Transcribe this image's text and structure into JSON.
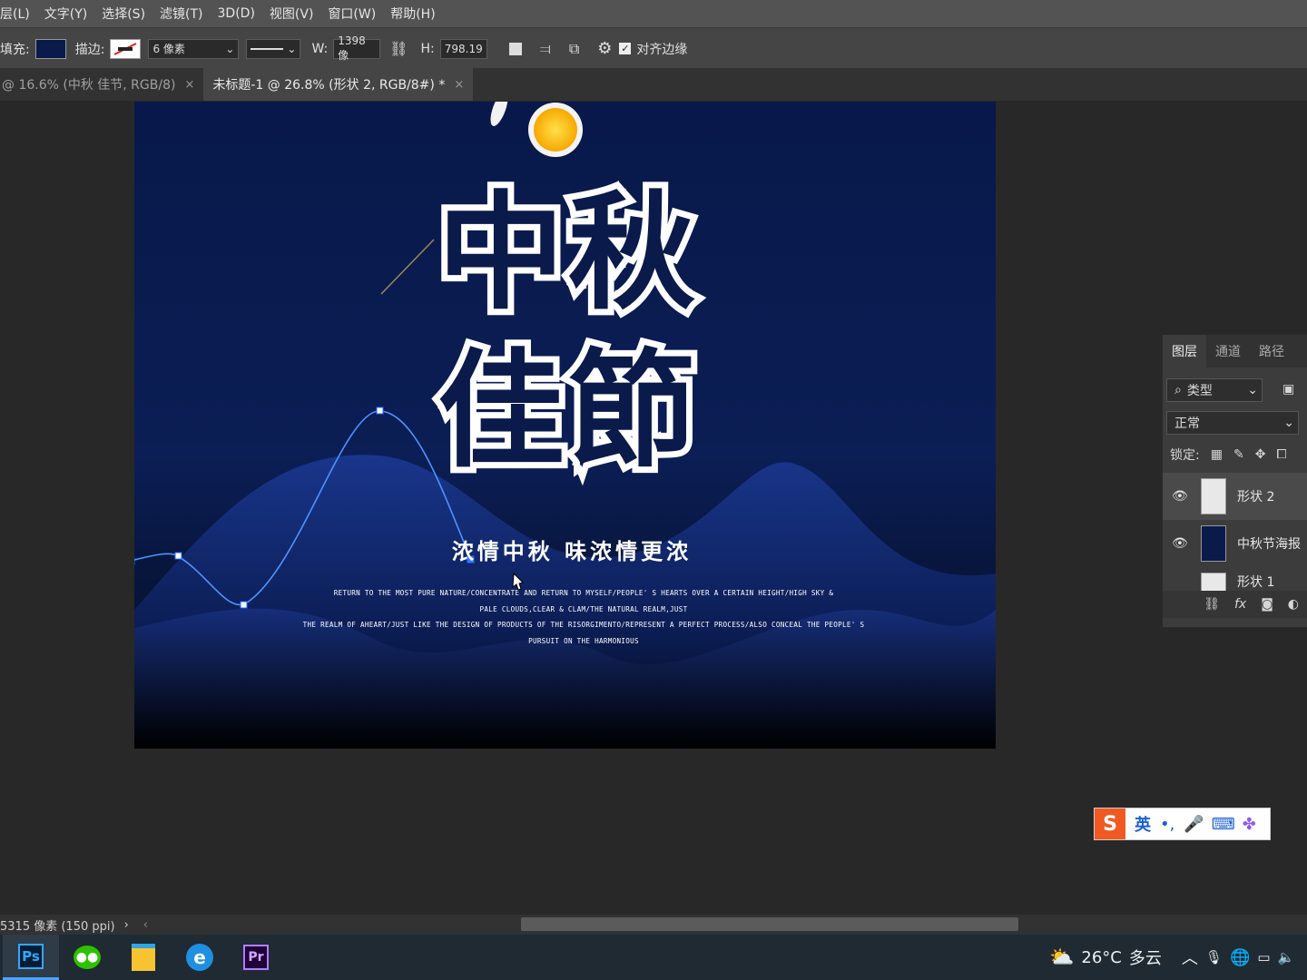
{
  "menu": [
    "层(L)",
    "文字(Y)",
    "选择(S)",
    "滤镜(T)",
    "3D(D)",
    "视图(V)",
    "窗口(W)",
    "帮助(H)"
  ],
  "options": {
    "fill_label": "填充:",
    "fill_color": "#0a1a4a",
    "stroke_label": "描边:",
    "stroke_width": "6 像素",
    "w_label": "W:",
    "w_value": "1398 像",
    "h_label": "H:",
    "h_value": "798.19",
    "align_edges_label": "对齐边缘",
    "align_edges_checked": true
  },
  "tabs": [
    {
      "label": "@ 16.6% (中秋 佳节, RGB/8)",
      "close": "×",
      "active": false
    },
    {
      "label": "未标题-1 @ 26.8% (形状 2, RGB/8#) *",
      "close": "×",
      "active": true
    }
  ],
  "poster": {
    "title_line1": "中秋",
    "title_line2": "佳節",
    "subtitle": "浓情中秋 味浓情更浓",
    "body_lines": [
      "RETURN TO THE MOST PURE NATURE/CONCENTRATE AND RETURN TO MYSELF/PEOPLE' S HEARTS OVER A CERTAIN HEIGHT/HIGH SKY &",
      "PALE CLOUDS,CLEAR & CLAM/THE NATURAL REALM,JUST",
      "THE REALM OF AHEART/JUST LIKE THE DESIGN OF PRODUCTS OF THE RISORGIMENTO/REPRESENT A PERFECT PROCESS/ALSO CONCEAL THE PEOPLE' S",
      "PURSUIT ON THE HARMONIOUS"
    ],
    "bg_color": "#0a1a4a"
  },
  "layers_panel": {
    "tabs": [
      "图层",
      "通道",
      "路径"
    ],
    "filter_label": "类型",
    "blend_mode": "正常",
    "lock_label": "锁定:",
    "layers": [
      {
        "name": "形状 2",
        "visible": true,
        "selected": true
      },
      {
        "name": "中秋节海报",
        "visible": true,
        "selected": false
      },
      {
        "name": "形状 1",
        "visible": true,
        "selected": false
      }
    ]
  },
  "status": {
    "doc_info": "5315 像素 (150 ppi)",
    "arrow": "›",
    "prev": "‹"
  },
  "ime": {
    "mode": "英",
    "punct": "•,"
  },
  "taskbar": {
    "apps": [
      "ps-icon",
      "wechat-icon",
      "notepad-icon",
      "ie-icon",
      "premiere-icon"
    ],
    "ps_label": "Ps",
    "pr_label": "Pr",
    "weather_temp": "26°C",
    "weather_desc": "多云"
  }
}
